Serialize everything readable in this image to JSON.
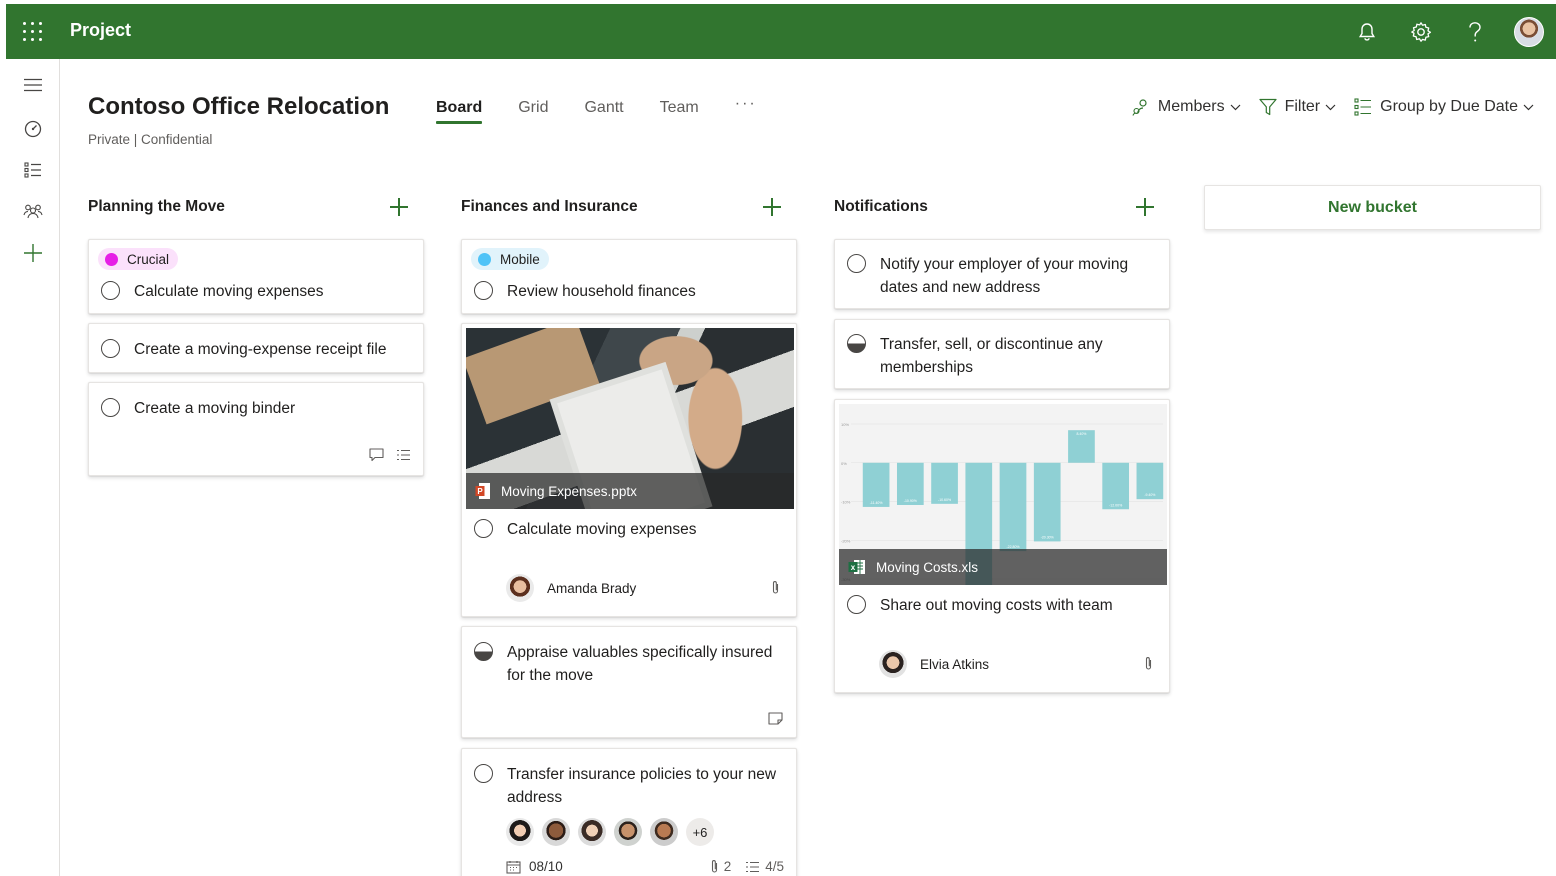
{
  "app": {
    "title": "Project"
  },
  "header": {
    "plan_title": "Contoso Office Relocation",
    "plan_subtitle": "Private | Confidential",
    "tabs": [
      {
        "label": "Board",
        "active": true
      },
      {
        "label": "Grid",
        "active": false
      },
      {
        "label": "Gantt",
        "active": false
      },
      {
        "label": "Team",
        "active": false
      }
    ],
    "more_label": "···",
    "actions": {
      "members": "Members",
      "filter": "Filter",
      "group_by": "Group by Due Date"
    }
  },
  "colors": {
    "brand": "#31752f",
    "crucial": "#e61ee6",
    "mobile": "#4fc3f7",
    "chart_bar": "#8fd0d4"
  },
  "buckets": [
    {
      "name": "Planning the Move",
      "cards": [
        {
          "label": "Crucial",
          "title": "Calculate moving expenses"
        },
        {
          "title": "Create a moving-expense receipt file"
        },
        {
          "title": "Create a moving binder",
          "icons": [
            "comment-icon",
            "checklist-icon"
          ]
        }
      ]
    },
    {
      "name": "Finances and Insurance",
      "cards": [
        {
          "label": "Mobile",
          "title": "Review household finances"
        },
        {
          "attachment": "Moving Expenses.pptx",
          "title": "Calculate moving expenses",
          "assignee": "Amanda Brady"
        },
        {
          "title": "Appraise valuables specifically insured for the move",
          "progress": "in progress"
        },
        {
          "title": "Transfer insurance policies to your new address",
          "extra_people": "+6",
          "due": "08/10",
          "attachments": "2",
          "checklist": "4/5"
        }
      ]
    },
    {
      "name": "Notifications",
      "cards": [
        {
          "title": "Notify your employer of your moving dates and new address"
        },
        {
          "title": "Transfer, sell, or discontinue any memberships",
          "progress": "in progress"
        },
        {
          "attachment": "Moving Costs.xls",
          "title": "Share out moving costs with team",
          "assignee": "Elvia Atkins"
        }
      ]
    }
  ],
  "new_bucket_label": "New bucket",
  "chart_data": {
    "type": "bar",
    "title": "",
    "xlabel": "",
    "ylabel": "",
    "ylim": [
      -30,
      10
    ],
    "categories": [
      "1",
      "2",
      "3",
      "4",
      "5",
      "6",
      "7",
      "8",
      "9"
    ],
    "values": [
      -11.4,
      -10.9,
      -10.6,
      -34.3,
      -22.8,
      -20.3,
      8.4,
      -12.0,
      -9.4
    ],
    "tick_labels": [
      "10%",
      "0%",
      "-10%",
      "-20%",
      "-30%"
    ]
  }
}
